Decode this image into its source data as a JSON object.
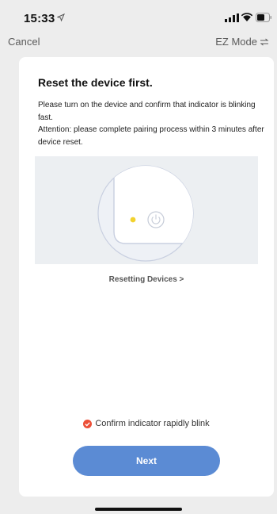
{
  "status_bar": {
    "time": "15:33",
    "icons": [
      "location-arrow-icon",
      "signal-icon",
      "wifi-icon",
      "battery-icon"
    ]
  },
  "nav": {
    "cancel_label": "Cancel",
    "mode_label": "EZ Mode",
    "mode_icon": "swap-icon"
  },
  "card": {
    "title": "Reset the device first.",
    "description_1": "Please turn on the device and confirm that indicator is blinking fast.",
    "description_2": "Attention: please complete pairing process within 3 minutes after device reset.",
    "resetting_link": "Resetting Devices >",
    "confirm_label": "Confirm indicator rapidly blink",
    "next_label": "Next"
  },
  "colors": {
    "accent": "#5b8bd4",
    "confirm_check": "#ec4f37",
    "indicator_led": "#f2d22e",
    "background": "#ededed"
  }
}
